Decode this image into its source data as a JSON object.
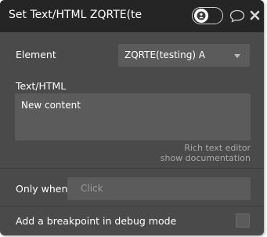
{
  "header": {
    "title": "Set Text/HTML ZQRTE(te",
    "icons": {
      "toggle_knob": "user-icon",
      "comment": "comment-icon",
      "close": "close-icon"
    }
  },
  "fields": {
    "element": {
      "label": "Element",
      "value": "ZQRTE(testing) A"
    },
    "text_html": {
      "label": "Text/HTML",
      "value": "New content",
      "hint_editor": "Rich text editor",
      "hint_docs": "show documentation"
    },
    "only_when": {
      "label": "Only when",
      "placeholder": "Click"
    },
    "breakpoint": {
      "label": "Add a breakpoint in debug mode",
      "checked": false
    }
  },
  "colors": {
    "panel_bg": "#4a4a4a",
    "header_bg": "#252525",
    "field_bg": "#5b5b5b",
    "hint_text": "#a8a8a8"
  }
}
